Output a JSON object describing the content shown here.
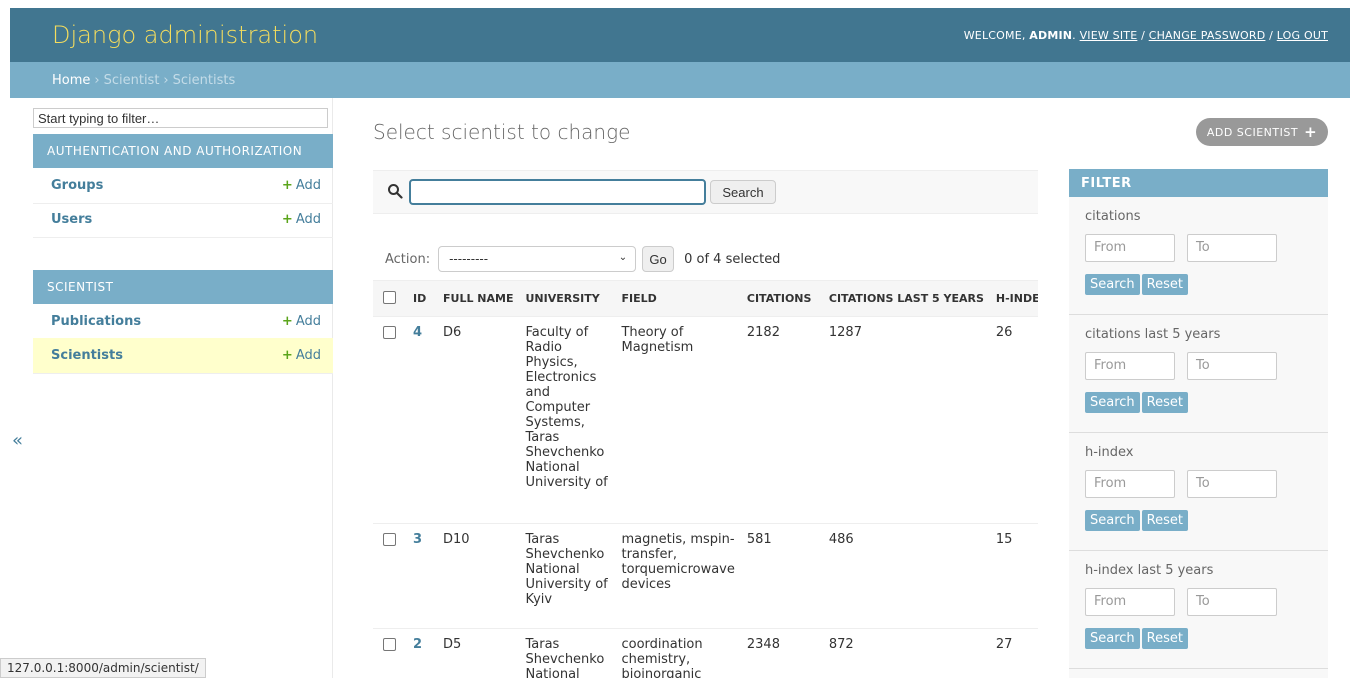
{
  "header": {
    "brand": "Django administration",
    "welcome": "WELCOME,",
    "user": "ADMIN",
    "view_site": "VIEW SITE",
    "change_password": "CHANGE PASSWORD",
    "logout": "LOG OUT",
    "sep1": ".",
    "sep2": "/",
    "sep3": "/"
  },
  "breadcrumbs": {
    "home": "Home",
    "app": "Scientist",
    "model": "Scientists",
    "separator": "›"
  },
  "sidebar": {
    "filter_placeholder": "Start typing to filter…",
    "modules": [
      {
        "caption": "AUTHENTICATION AND AUTHORIZATION",
        "models": [
          {
            "name": "Groups",
            "add": "Add"
          },
          {
            "name": "Users",
            "add": "Add"
          }
        ]
      },
      {
        "caption": "SCIENTIST",
        "models": [
          {
            "name": "Publications",
            "add": "Add"
          },
          {
            "name": "Scientists",
            "add": "Add",
            "current": true
          }
        ]
      }
    ],
    "toggle": "«"
  },
  "content": {
    "title": "Select scientist to change",
    "add_button": "ADD SCIENTIST"
  },
  "search": {
    "button": "Search",
    "value": ""
  },
  "actions": {
    "label": "Action:",
    "selected_option": "---------",
    "go": "Go",
    "counter": "0 of 4 selected"
  },
  "table": {
    "headers": [
      "ID",
      "FULL NAME",
      "UNIVERSITY",
      "FIELD",
      "CITATIONS",
      "CITATIONS LAST 5 YEARS",
      "H-INDEX"
    ],
    "rows": [
      {
        "id": "4",
        "full_name": "D6",
        "university": "Faculty of Radio Physics, Electronics and Computer Systems, Taras Shevchenko National University of",
        "field": "Theory of Magnetism",
        "citations": "2182",
        "citations_5y": "1287",
        "h_index": "26"
      },
      {
        "id": "3",
        "full_name": "D10",
        "university": "Taras Shevchenko National University of Kyiv",
        "field": "magnetis, mspin-transfer, torquemicrowave devices",
        "citations": "581",
        "citations_5y": "486",
        "h_index": "15"
      },
      {
        "id": "2",
        "full_name": "D5",
        "university": "Taras Shevchenko National",
        "field": "coordination chemistry, bioinorganic",
        "citations": "2348",
        "citations_5y": "872",
        "h_index": "27"
      }
    ]
  },
  "filter": {
    "caption": "FILTER",
    "from_placeholder": "From",
    "to_placeholder": "To",
    "search_label": "Search",
    "reset_label": "Reset",
    "sections": [
      {
        "title": "citations"
      },
      {
        "title": "citations last 5 years"
      },
      {
        "title": "h-index"
      },
      {
        "title": "h-index last 5 years"
      }
    ]
  },
  "statusbar": {
    "url": "127.0.0.1:8000/admin/scientist/"
  },
  "colors": {
    "header_bg": "#417690",
    "brand": "#f5dd5d",
    "accent": "#79aec8",
    "link": "#447e9b",
    "add_green": "#5ba51b",
    "current_row": "#ffffcc"
  }
}
